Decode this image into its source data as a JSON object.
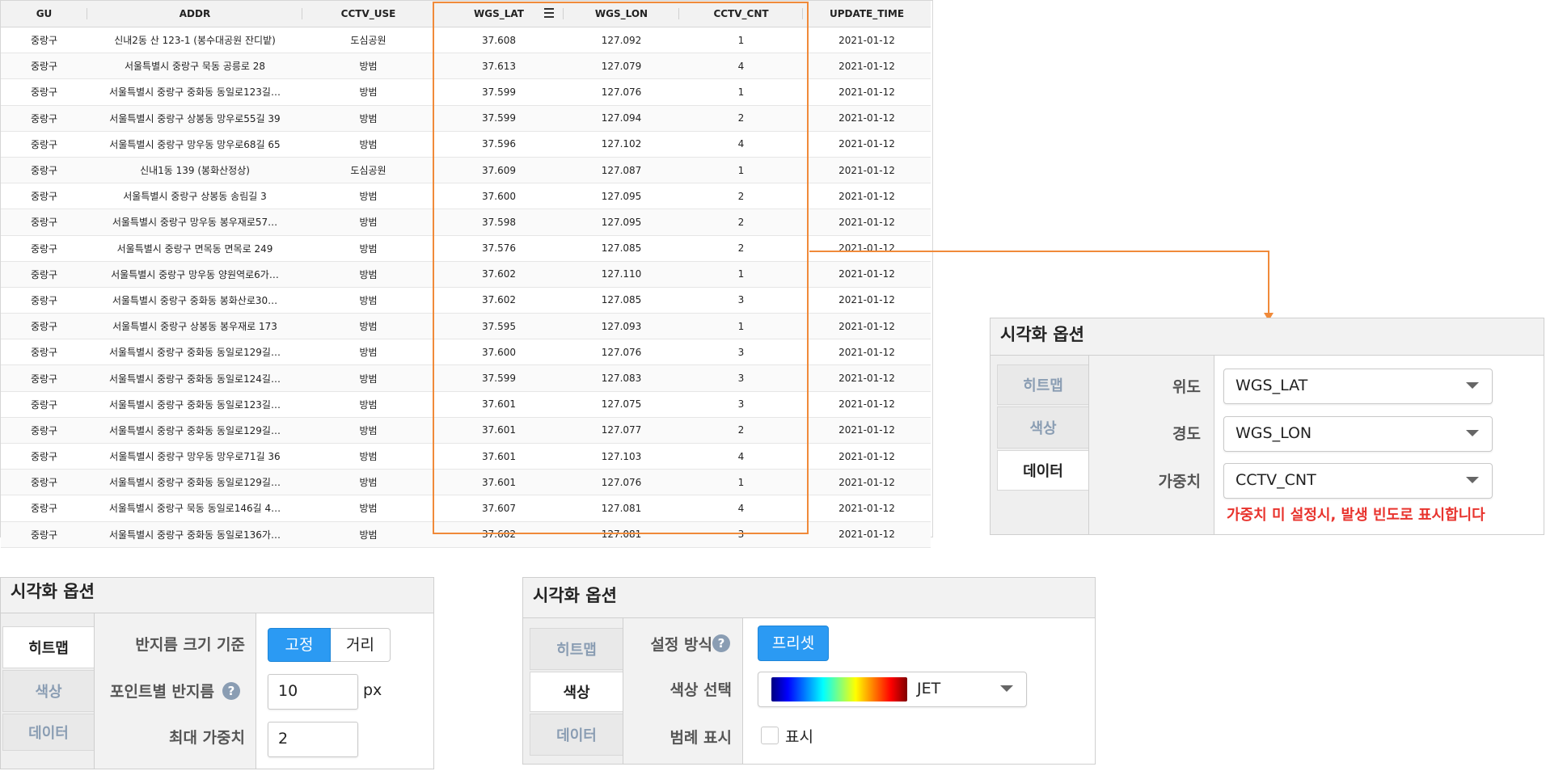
{
  "table": {
    "columns": [
      "GU",
      "ADDR",
      "CCTV_USE",
      "WGS_LAT",
      "WGS_LON",
      "CCTV_CNT",
      "UPDATE_TIME"
    ],
    "rows": [
      [
        "중랑구",
        "신내2동 산 123-1 (봉수대공원 잔디밭)",
        "도심공원",
        "37.608",
        "127.092",
        "1",
        "2021-01-12"
      ],
      [
        "중랑구",
        "서울특별시 중랑구 묵동 공릉로 28",
        "방범",
        "37.613",
        "127.079",
        "4",
        "2021-01-12"
      ],
      [
        "중랑구",
        "서울특별시 중랑구 중화동 동일로123길…",
        "방범",
        "37.599",
        "127.076",
        "1",
        "2021-01-12"
      ],
      [
        "중랑구",
        "서울특별시 중랑구 상봉동 망우로55길 39",
        "방범",
        "37.599",
        "127.094",
        "2",
        "2021-01-12"
      ],
      [
        "중랑구",
        "서울특별시 중랑구 망우동 망우로68길 65",
        "방범",
        "37.596",
        "127.102",
        "4",
        "2021-01-12"
      ],
      [
        "중랑구",
        "신내1동 139 (봉화산정상)",
        "도심공원",
        "37.609",
        "127.087",
        "1",
        "2021-01-12"
      ],
      [
        "중랑구",
        "서울특별시 중랑구 상봉동 송림길 3",
        "방범",
        "37.600",
        "127.095",
        "2",
        "2021-01-12"
      ],
      [
        "중랑구",
        "서울특별시 중랑구 망우동 봉우재로57…",
        "방범",
        "37.598",
        "127.095",
        "2",
        "2021-01-12"
      ],
      [
        "중랑구",
        "서울특별시 중랑구 면목동 면목로 249",
        "방범",
        "37.576",
        "127.085",
        "2",
        "2021-01-12"
      ],
      [
        "중랑구",
        "서울특별시 중랑구 망우동 양원역로6가…",
        "방범",
        "37.602",
        "127.110",
        "1",
        "2021-01-12"
      ],
      [
        "중랑구",
        "서울특별시 중랑구 중화동 봉화산로30…",
        "방범",
        "37.602",
        "127.085",
        "3",
        "2021-01-12"
      ],
      [
        "중랑구",
        "서울특별시 중랑구 상봉동 봉우재로 173",
        "방범",
        "37.595",
        "127.093",
        "1",
        "2021-01-12"
      ],
      [
        "중랑구",
        "서울특별시 중랑구 중화동 동일로129길…",
        "방범",
        "37.600",
        "127.076",
        "3",
        "2021-01-12"
      ],
      [
        "중랑구",
        "서울특별시 중랑구 중화동 동일로124길…",
        "방범",
        "37.599",
        "127.083",
        "3",
        "2021-01-12"
      ],
      [
        "중랑구",
        "서울특별시 중랑구 중화동 동일로123길…",
        "방범",
        "37.601",
        "127.075",
        "3",
        "2021-01-12"
      ],
      [
        "중랑구",
        "서울특별시 중랑구 중화동 동일로129길…",
        "방범",
        "37.601",
        "127.077",
        "2",
        "2021-01-12"
      ],
      [
        "중랑구",
        "서울특별시 중랑구 망우동 망우로71길 36",
        "방범",
        "37.601",
        "127.103",
        "4",
        "2021-01-12"
      ],
      [
        "중랑구",
        "서울특별시 중랑구 중화동 동일로129길…",
        "방범",
        "37.601",
        "127.076",
        "1",
        "2021-01-12"
      ],
      [
        "중랑구",
        "서울특별시 중랑구 묵동 동일로146길 4…",
        "방범",
        "37.607",
        "127.081",
        "4",
        "2021-01-12"
      ],
      [
        "중랑구",
        "서울특별시 중랑구 중화동 동일로136가…",
        "방범",
        "37.602",
        "127.081",
        "3",
        "2021-01-12"
      ]
    ]
  },
  "data_panel": {
    "title": "시각화 옵션",
    "tabs": [
      "히트맵",
      "색상",
      "데이터"
    ],
    "active_tab": "데이터",
    "fields": [
      {
        "label": "위도",
        "value": "WGS_LAT"
      },
      {
        "label": "경도",
        "value": "WGS_LON"
      },
      {
        "label": "가중치",
        "value": "CCTV_CNT"
      }
    ],
    "note": "가중치 미 설정시, 발생 빈도로 표시합니다"
  },
  "heatmap_panel": {
    "title": "시각화 옵션",
    "tabs": [
      "히트맵",
      "색상",
      "데이터"
    ],
    "active_tab": "히트맵",
    "radius_basis_label": "반지름 크기 기준",
    "radius_basis_options": [
      "고정",
      "거리"
    ],
    "radius_basis_selected": "고정",
    "point_radius_label": "포인트별 반지름",
    "point_radius_value": "10",
    "point_radius_unit": "px",
    "max_weight_label": "최대 가중치",
    "max_weight_value": "2"
  },
  "color_panel": {
    "title": "시각화 옵션",
    "tabs": [
      "히트맵",
      "색상",
      "데이터"
    ],
    "active_tab": "색상",
    "setting_label": "설정 방식",
    "preset_button": "프리셋",
    "color_select_label": "색상 선택",
    "color_select_value": "JET",
    "legend_label": "범례 표시",
    "legend_checkbox_label": "표시",
    "legend_checked": false
  },
  "colors": {
    "highlight": "#f08a3a",
    "primary_button": "#2b9af3",
    "warning_text": "#e8332d",
    "inactive_tab_text": "#8a9db3"
  }
}
